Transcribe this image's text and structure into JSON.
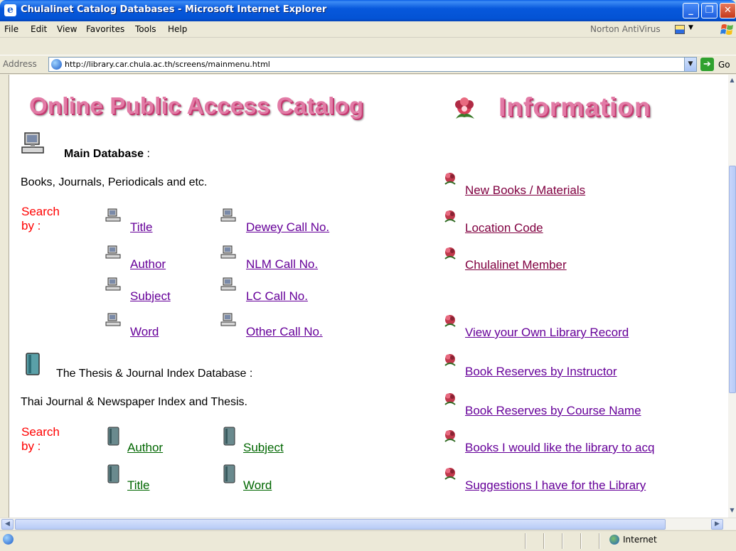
{
  "window": {
    "title": "Chulalinet Catalog Databases - Microsoft Internet Explorer",
    "btn_minimize": "_",
    "btn_restore": "❐",
    "btn_close": "✕"
  },
  "menubar": {
    "items": [
      "File",
      "Edit",
      "View",
      "Favorites",
      "Tools",
      "Help"
    ],
    "norton": "Norton AntiVirus"
  },
  "addressbar": {
    "label": "Address",
    "url": "http://library.car.chula.ac.th/screens/mainmenu.html",
    "go_label": "Go"
  },
  "page": {
    "heading_left": "Online Public Access Catalog",
    "heading_right": "Information",
    "main_db": {
      "title": "Main Database",
      "colon": ":",
      "description": "Books, Journals, Periodicals and etc.",
      "search_by": [
        "Search",
        "by :"
      ],
      "links_col1": [
        "Title",
        "Author",
        "Subject",
        "Word"
      ],
      "links_col2": [
        "Dewey Call No.",
        "NLM Call No.",
        "LC Call No.",
        "Other Call No."
      ]
    },
    "thesis_db": {
      "title": "The Thesis & Journal Index Database",
      "colon": ":",
      "description": "Thai Journal & Newspaper Index and Thesis.",
      "search_by": [
        "Search",
        "by :"
      ],
      "links_col1": [
        "Author",
        "Title"
      ],
      "links_col2": [
        "Subject",
        "Word"
      ]
    },
    "info_links": [
      "New Books / Materials",
      "Location Code",
      "Chulalinet Member",
      "View your Own Library Record",
      "Book Reserves by Instructor",
      "Book Reserves by Course Name",
      "Books I would like the library to acq",
      "Suggestions I have for the Library"
    ]
  },
  "statusbar": {
    "zone": "Internet"
  },
  "colors": {
    "titlebar": "#0454d8",
    "heading_pink": "#e27ba6",
    "search_red": "#ff0000",
    "link_purple": "#660099",
    "link_green": "#006600",
    "link_maroon": "#800040"
  }
}
